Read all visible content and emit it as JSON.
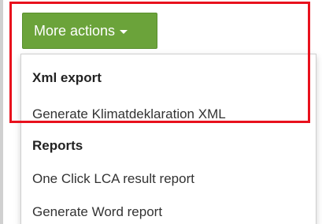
{
  "button": {
    "label": "More actions"
  },
  "menu": {
    "sections": [
      {
        "header": "Xml export",
        "items": [
          "Generate Klimatdeklaration XML"
        ]
      },
      {
        "header": "Reports",
        "items": [
          "One Click LCA result report",
          "Generate Word report"
        ]
      }
    ]
  },
  "colors": {
    "button_bg": "#6ba33a",
    "highlight": "#e8111d"
  },
  "icons": {
    "caret": "caret-down-icon"
  }
}
